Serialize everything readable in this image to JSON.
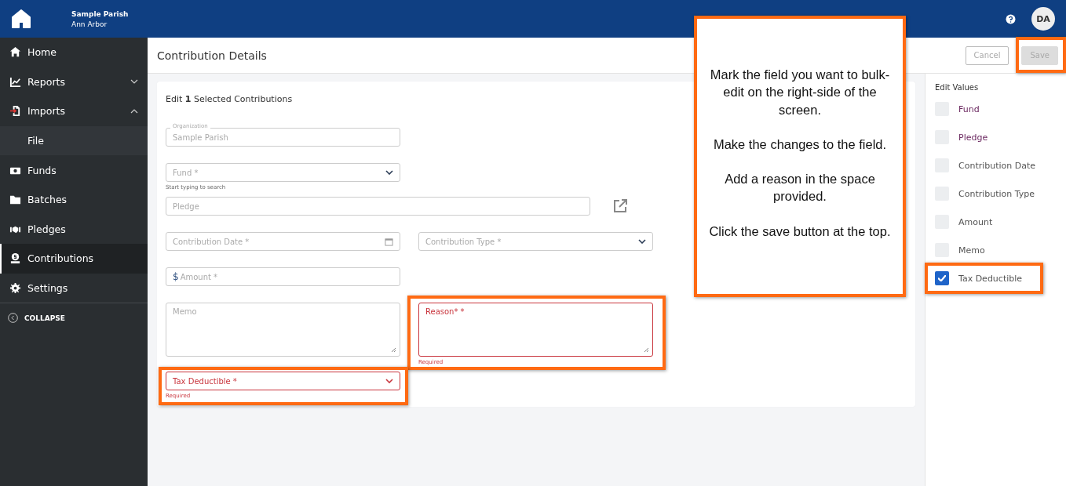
{
  "topbar": {
    "org_name": "Sample Parish",
    "org_location": "Ann Arbor",
    "avatar": "DA"
  },
  "sidebar": {
    "items": [
      {
        "label": "Home",
        "selected": false
      },
      {
        "label": "Reports",
        "selected": false,
        "expanded": false
      },
      {
        "label": "Imports",
        "selected": false,
        "expanded": true,
        "children": [
          {
            "label": "File",
            "selected": false
          }
        ]
      },
      {
        "label": "Funds",
        "selected": false
      },
      {
        "label": "Batches",
        "selected": false
      },
      {
        "label": "Pledges",
        "selected": false
      },
      {
        "label": "Contributions",
        "selected": true
      },
      {
        "label": "Settings",
        "selected": false
      }
    ],
    "collapse": "COLLAPSE"
  },
  "page_title": "Contribution Details",
  "buttons": [
    {
      "label": "Cancel",
      "kind": "outline"
    },
    {
      "label": "Save",
      "kind": "filled",
      "disabled": true,
      "highlighted": true
    }
  ],
  "form": {
    "heading": "Edit **1** Selected Contributions",
    "rows": [
      [
        {
          "kind": "text",
          "label": "Organization",
          "value": "Sample Parish"
        }
      ],
      [
        {
          "kind": "select",
          "placeholder": "Fund *",
          "helper": "Start typing to search"
        }
      ],
      [
        {
          "kind": "link-text",
          "placeholder": "Pledge"
        }
      ],
      [
        {
          "kind": "date",
          "placeholder": "Contribution Date *"
        },
        {
          "kind": "select",
          "placeholder": "Contribution Type *"
        }
      ],
      [
        {
          "kind": "amount",
          "prefix": "$",
          "placeholder": "Amount *"
        }
      ],
      [
        {
          "kind": "textarea",
          "placeholder": "Memo"
        },
        {
          "kind": "textarea",
          "placeholder": "Reason* *",
          "error": "Required",
          "highlighted": true
        }
      ],
      [
        {
          "kind": "select",
          "placeholder": "Tax Deductible *",
          "error": "Required",
          "highlighted": true
        }
      ]
    ]
  },
  "edit_values": {
    "title": "Edit Values",
    "items": [
      {
        "label": "Fund",
        "checked": false
      },
      {
        "label": "Pledge",
        "checked": false
      },
      {
        "label": "Contribution Date",
        "checked": false
      },
      {
        "label": "Contribution Type",
        "checked": false
      },
      {
        "label": "Amount",
        "checked": false
      },
      {
        "label": "Memo",
        "checked": false
      },
      {
        "label": "Tax Deductible",
        "checked": true,
        "highlighted": true
      }
    ]
  },
  "callout": {
    "paragraphs": [
      "Mark the field you want to bulk-edit on the right-side of the screen.",
      "Make the changes to the field.",
      "Add a reason in the space provided.",
      "Click the save button at the top."
    ]
  }
}
